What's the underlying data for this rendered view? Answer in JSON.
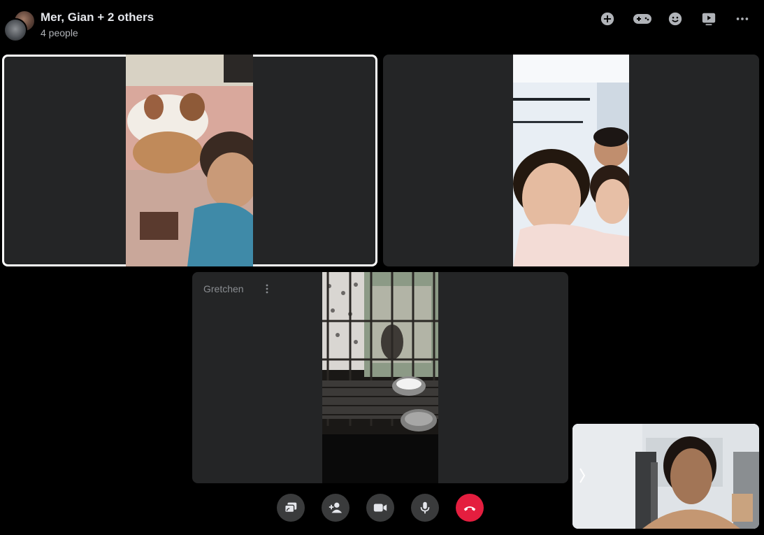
{
  "header": {
    "title": "Mer, Gian + 2 others",
    "subtitle": "4 people",
    "icons": [
      "add-icon",
      "game-controller-icon",
      "emoji-icon",
      "watch-together-icon",
      "more-icon"
    ]
  },
  "participants": [
    {
      "name": "",
      "active": true
    },
    {
      "name": "",
      "active": false
    },
    {
      "name": "Gretchen",
      "active": false
    }
  ],
  "controls": [
    "share-screen-icon",
    "add-person-icon",
    "camera-icon",
    "microphone-icon",
    "end-call-icon"
  ],
  "colors": {
    "background": "#000000",
    "tile": "#242526",
    "end_call": "#e41e3f",
    "control": "#3a3b3c"
  }
}
